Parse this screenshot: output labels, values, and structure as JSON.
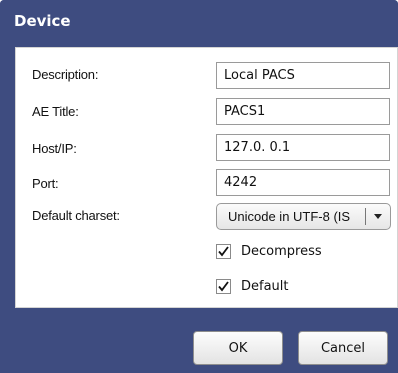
{
  "dialog": {
    "title": "Device"
  },
  "form": {
    "description": {
      "label": "Description:",
      "value": "Local PACS"
    },
    "ae_title": {
      "label": "AE Title:",
      "value": "PACS1"
    },
    "host": {
      "label": "Host/IP:",
      "value": "127.0. 0.1"
    },
    "port": {
      "label": "Port:",
      "value": "4242"
    },
    "charset": {
      "label": "Default charset:",
      "selected": "Unicode in UTF-8 (IS"
    },
    "decompress": {
      "label": "Decompress",
      "checked": true
    },
    "default": {
      "label": "Default",
      "checked": true
    }
  },
  "buttons": {
    "ok": "OK",
    "cancel": "Cancel"
  },
  "colors": {
    "titlebar": "#3e4c80",
    "panel": "#ffffff"
  },
  "icons": {
    "dropdown": "chevron-down-icon",
    "check": "checkmark-icon"
  }
}
